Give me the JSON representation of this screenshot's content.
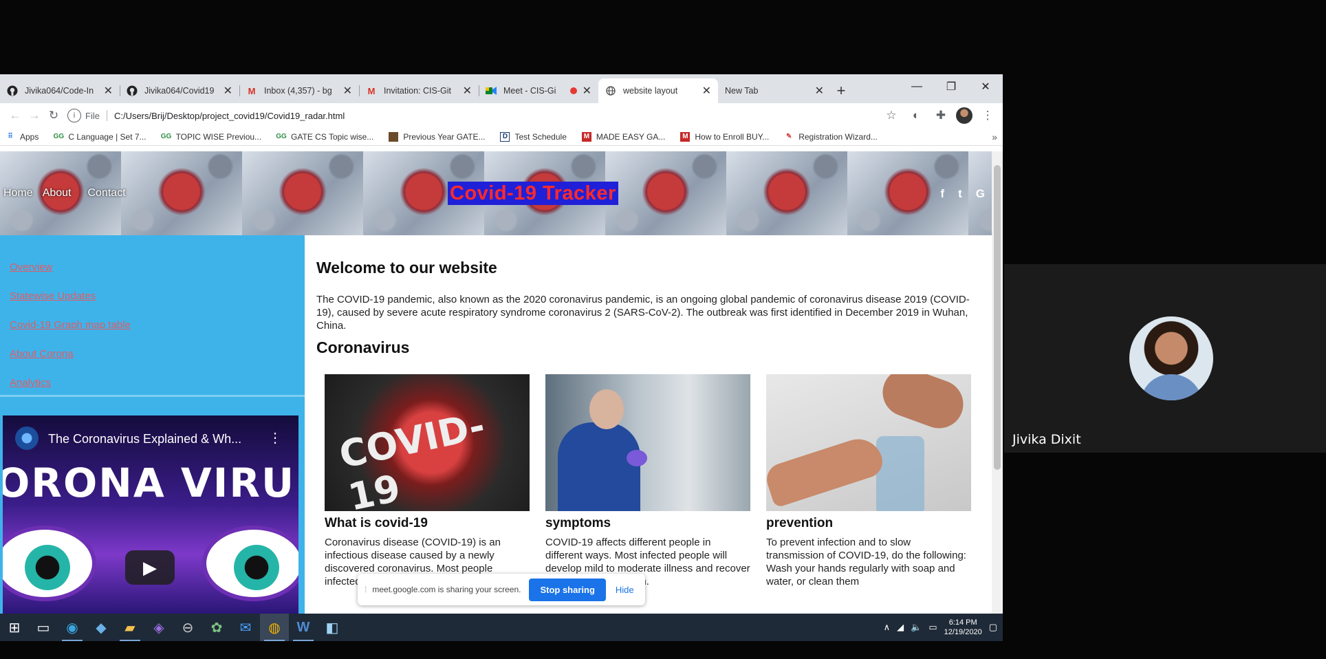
{
  "browser": {
    "tabs": [
      {
        "label": "Jivika064/Code-In",
        "icon": "github-icon"
      },
      {
        "label": "Jivika064/Covid19",
        "icon": "github-icon"
      },
      {
        "label": "Inbox (4,357) - bg",
        "icon": "gmail-icon"
      },
      {
        "label": "Invitation: CIS-Git",
        "icon": "gmail-icon"
      },
      {
        "label": "Meet - CIS-Gi",
        "icon": "meet-icon"
      },
      {
        "label": "website layout",
        "icon": "globe-icon"
      },
      {
        "label": "New Tab",
        "icon": ""
      }
    ],
    "active_tab": 5,
    "scheme_label": "File",
    "url": "C:/Users/Brij/Desktop/project_covid19/Covid19_radar.html",
    "bookmarks": [
      {
        "label": "Apps",
        "icon": "apps-grid-icon"
      },
      {
        "label": "C Language | Set 7...",
        "icon": "gfg-icon"
      },
      {
        "label": "TOPIC WISE Previou...",
        "icon": "gfg-icon"
      },
      {
        "label": "GATE CS Topic wise...",
        "icon": "gfg-icon"
      },
      {
        "label": "Previous Year GATE...",
        "icon": "bookmark-image-icon"
      },
      {
        "label": "Test Schedule",
        "icon": "doc-icon"
      },
      {
        "label": "MADE EASY GA...",
        "icon": "madeeasy-icon"
      },
      {
        "label": "How to Enroll BUY...",
        "icon": "madeeasy-icon"
      },
      {
        "label": "Registration Wizard...",
        "icon": "wizard-icon"
      }
    ]
  },
  "site": {
    "nav": [
      "Home",
      "About",
      "Contact"
    ],
    "title": "Covid-19 Tracker",
    "social": [
      "f",
      "t",
      "G"
    ],
    "sidebar_links": [
      "Overview",
      "Statewise Updates",
      "Covid-19 Graph map table",
      "About Corona",
      "Analytics"
    ],
    "video": {
      "title": "The Coronavirus Explained & Wh...",
      "banner": "ORONA VIRU"
    },
    "welcome_title": "Welcome to our website",
    "welcome_text": "The COVID-19 pandemic, also known as the 2020 coronavirus pandemic, is an ongoing global pandemic of coronavirus disease 2019 (COVID-19), caused by severe acute respiratory syndrome coronavirus 2 (SARS-CoV-2). The outbreak was first identified in December 2019 in Wuhan, China.",
    "section_title": "Coronavirus",
    "cards": [
      {
        "title": "What is covid-19",
        "image_text": "COVID-19",
        "text": "Coronavirus disease (COVID-19) is an infectious disease caused by a newly discovered coronavirus. Most people infected with the COVID-19 virus will"
      },
      {
        "title": "symptoms",
        "text": "COVID-19 affects different people in different ways. Most infected people will develop mild to moderate illness and recover without hospitalization."
      },
      {
        "title": "prevention",
        "text": "To prevent infection and to slow transmission of COVID-19, do the following: Wash your hands regularly with soap and water, or clean them"
      }
    ]
  },
  "share_banner": {
    "message": "meet.google.com is sharing your screen.",
    "stop_label": "Stop sharing",
    "hide_label": "Hide"
  },
  "taskbar": {
    "time": "6:14 PM",
    "date": "12/19/2020"
  },
  "meet": {
    "participant_name": "Jivika Dixit"
  }
}
